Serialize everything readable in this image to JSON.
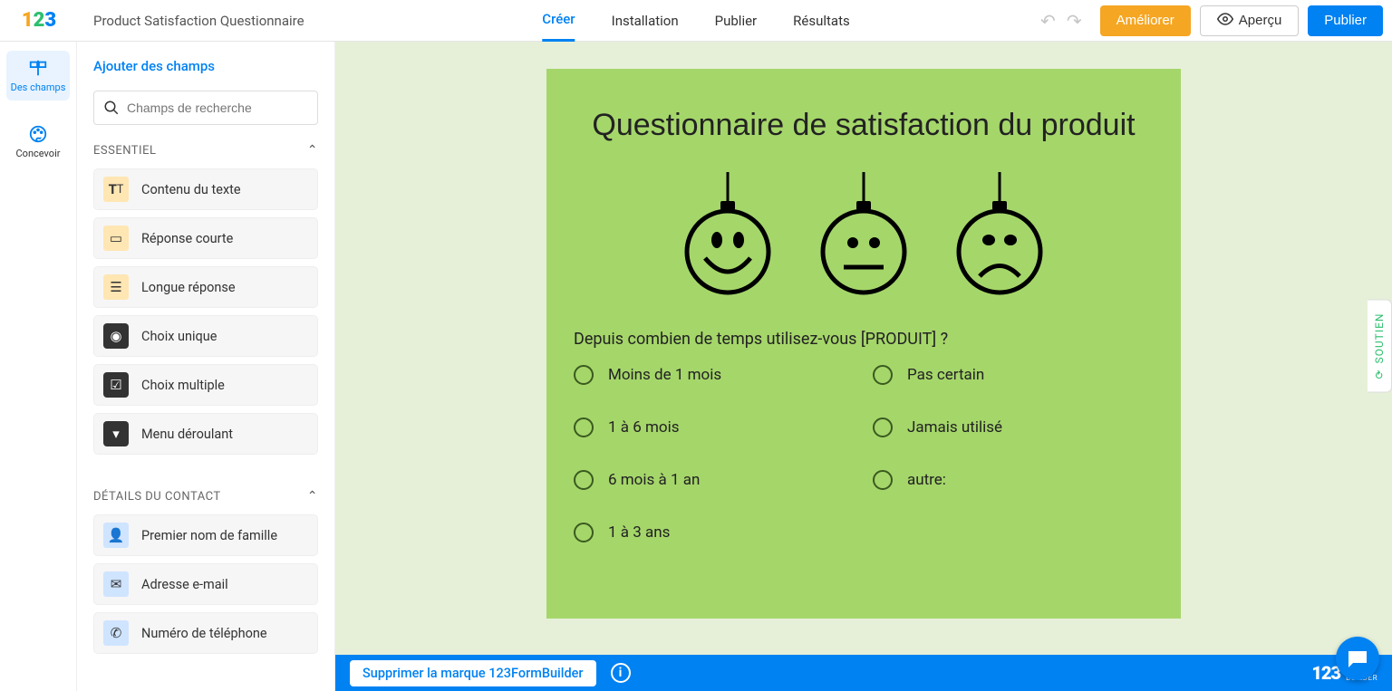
{
  "header": {
    "form_title": "Product Satisfaction Questionnaire",
    "tabs": {
      "create": "Créer",
      "setup": "Installation",
      "publish": "Publier",
      "results": "Résultats"
    },
    "buttons": {
      "improve": "Améliorer",
      "preview": "Aperçu",
      "publish": "Publier"
    }
  },
  "rail": {
    "fields": "Des champs",
    "design": "Concevoir"
  },
  "sidebar": {
    "add_fields": "Ajouter des champs",
    "search_placeholder": "Champs de recherche",
    "sections": {
      "essential": {
        "title": "ESSENTIEL",
        "items": {
          "text_content": "Contenu du texte",
          "short_answer": "Réponse courte",
          "long_answer": "Longue réponse",
          "single_choice": "Choix unique",
          "multiple_choice": "Choix multiple",
          "dropdown": "Menu déroulant"
        }
      },
      "contact": {
        "title": "DÉTAILS DU CONTACT",
        "items": {
          "first_last_name": "Premier nom de famille",
          "email": "Adresse e-mail",
          "phone": "Numéro de téléphone"
        }
      }
    }
  },
  "form": {
    "title": "Questionnaire de satisfaction du produit",
    "q1": {
      "label": "Depuis combien de temps utilisez-vous [PRODUIT] ?",
      "options": {
        "o1": "Moins de 1 mois",
        "o2": "Pas certain",
        "o3": "1 à 6 mois",
        "o4": "Jamais utilisé",
        "o5": "6 mois à 1 an",
        "o6": "autre:",
        "o7": "1 à 3 ans"
      }
    }
  },
  "footer": {
    "remove_brand": "Supprimer la marque 123FormBuilder",
    "brand_text": "FORM",
    "brand_sub": "BUILDER"
  },
  "support": "SOUTIEN"
}
